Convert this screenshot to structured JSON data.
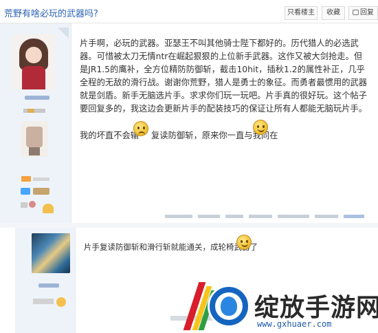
{
  "thread": {
    "title": "荒野有啥必玩的武器吗?"
  },
  "toolbar": {
    "author_only": "只看楼主",
    "favorite": "收藏",
    "reply": "回复"
  },
  "post1": {
    "paragraph": "片手啊，必玩的武器。亚瑟王不叫其他骑士陛下都好的。历代猎人的必选武器。可惜被太刀无情ntr在崛起狠狠的上位新手武器。这作又被大剑抢走。但是JR1.5的鹰补，全方位精防防御斩，截击10hit，插秋1.2的属性补正，几乎全程的无敌的滑行战。谢谢你荒野，猎人是勇士的象征。而勇者最惯用的武器就是剑盾。新手无脑选片手。求求你们玩一玩吧。片手真的很好玩。这个帖子要回复多的，我这边会更新片手的配装技巧的保证让所有人都能无脑玩片手。",
    "line2_a": "我的坏直不会输",
    "line2_b": "复读防御斩，原来你一直与我同在"
  },
  "post2": {
    "text": "片手复读防御斩和滑行斩就能通关，成轮椅武器了"
  },
  "watermark": {
    "title": "绽放手游网",
    "url": "www.gxhuaer.com"
  },
  "colors": {
    "link": "#2d64b3",
    "sidebar": "#eef3f9",
    "brand_blue": "#1565c0"
  }
}
